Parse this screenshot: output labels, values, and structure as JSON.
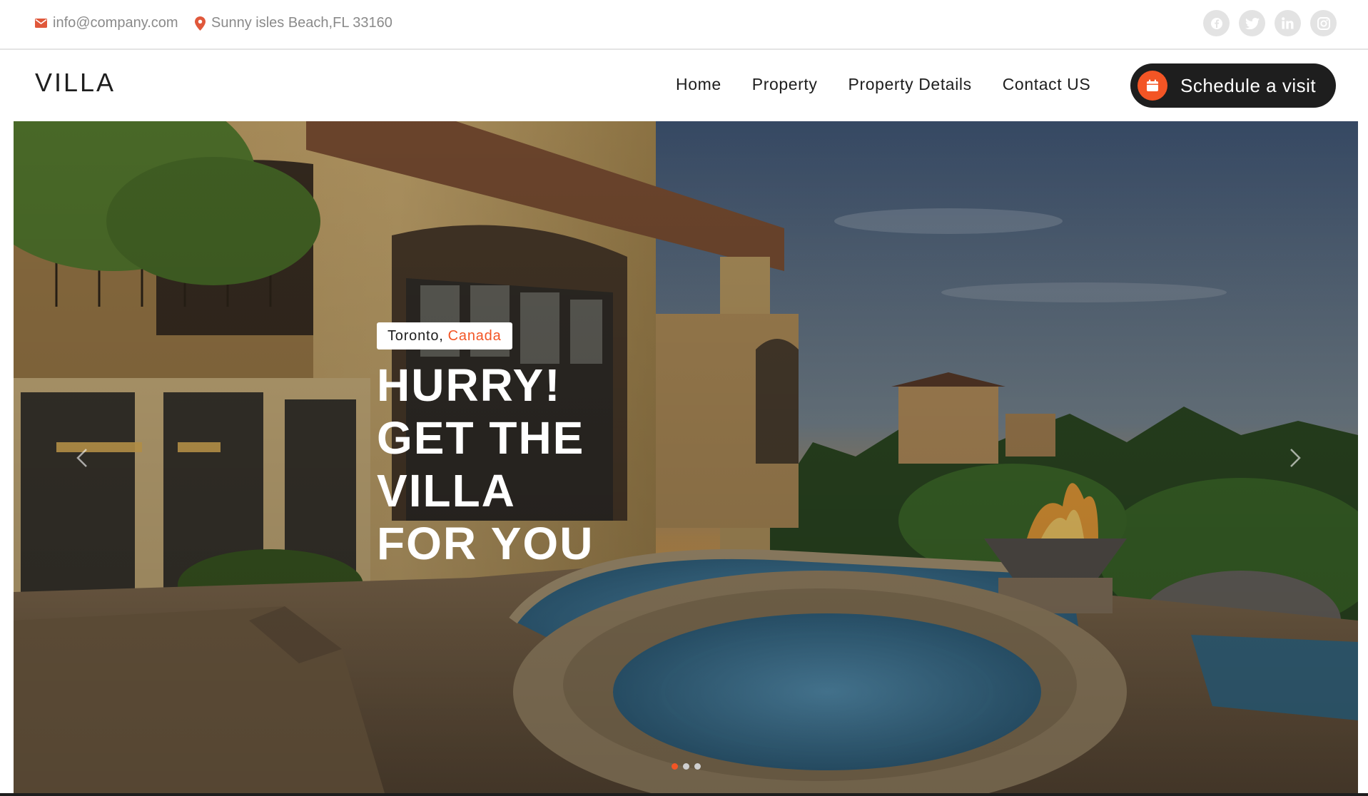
{
  "topbar": {
    "email": "info@company.com",
    "address": "Sunny isles Beach,FL 33160",
    "socials": [
      "facebook-icon",
      "twitter-icon",
      "linkedin-icon",
      "instagram-icon"
    ]
  },
  "header": {
    "logo": "VILLA",
    "nav": [
      "Home",
      "Property",
      "Property Details",
      "Contact US"
    ],
    "cta_label": "Schedule a visit",
    "cta_icon": "calendar-icon"
  },
  "hero": {
    "location_city": "Toronto,",
    "location_country": "Canada",
    "headline": [
      "HURRY!",
      "GET THE",
      "VILLA",
      "FOR YOU"
    ],
    "slides": 3,
    "active_slide": 1
  },
  "colors": {
    "accent": "#f35525",
    "dark": "#1e1e1e",
    "muted": "#8a8a8a"
  }
}
